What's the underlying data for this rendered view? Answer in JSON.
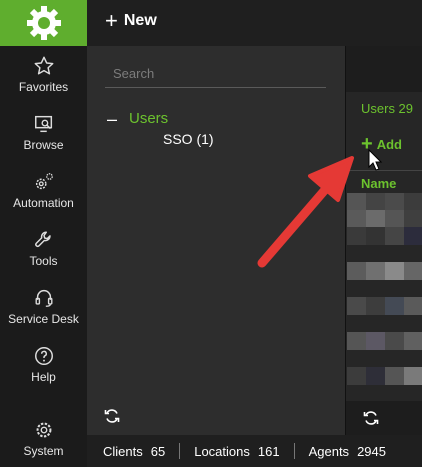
{
  "colors": {
    "accent": "#6cc22e",
    "logo_bg": "#5fae2e",
    "arrow": "#e53935"
  },
  "topbar": {
    "new_label": "New"
  },
  "nav": {
    "items": [
      {
        "label": "Favorites",
        "icon": "star-icon"
      },
      {
        "label": "Browse",
        "icon": "monitor-search-icon"
      },
      {
        "label": "Automation",
        "icon": "gears-icon"
      },
      {
        "label": "Tools",
        "icon": "wrench-icon"
      },
      {
        "label": "Service Desk",
        "icon": "headset-icon"
      },
      {
        "label": "Help",
        "icon": "question-icon"
      },
      {
        "label": "System",
        "icon": "gear-icon"
      }
    ]
  },
  "tree": {
    "search_placeholder": "Search",
    "collapse_symbol": "–",
    "root_label": "Users",
    "child_label": "SSO (1)"
  },
  "list": {
    "users_count": "Users 29",
    "add_label": "Add",
    "column_name": "Name"
  },
  "status": {
    "clients_label": "Clients",
    "clients_value": "65",
    "locations_label": "Locations",
    "locations_value": "161",
    "agents_label": "Agents",
    "agents_value": "2945"
  }
}
